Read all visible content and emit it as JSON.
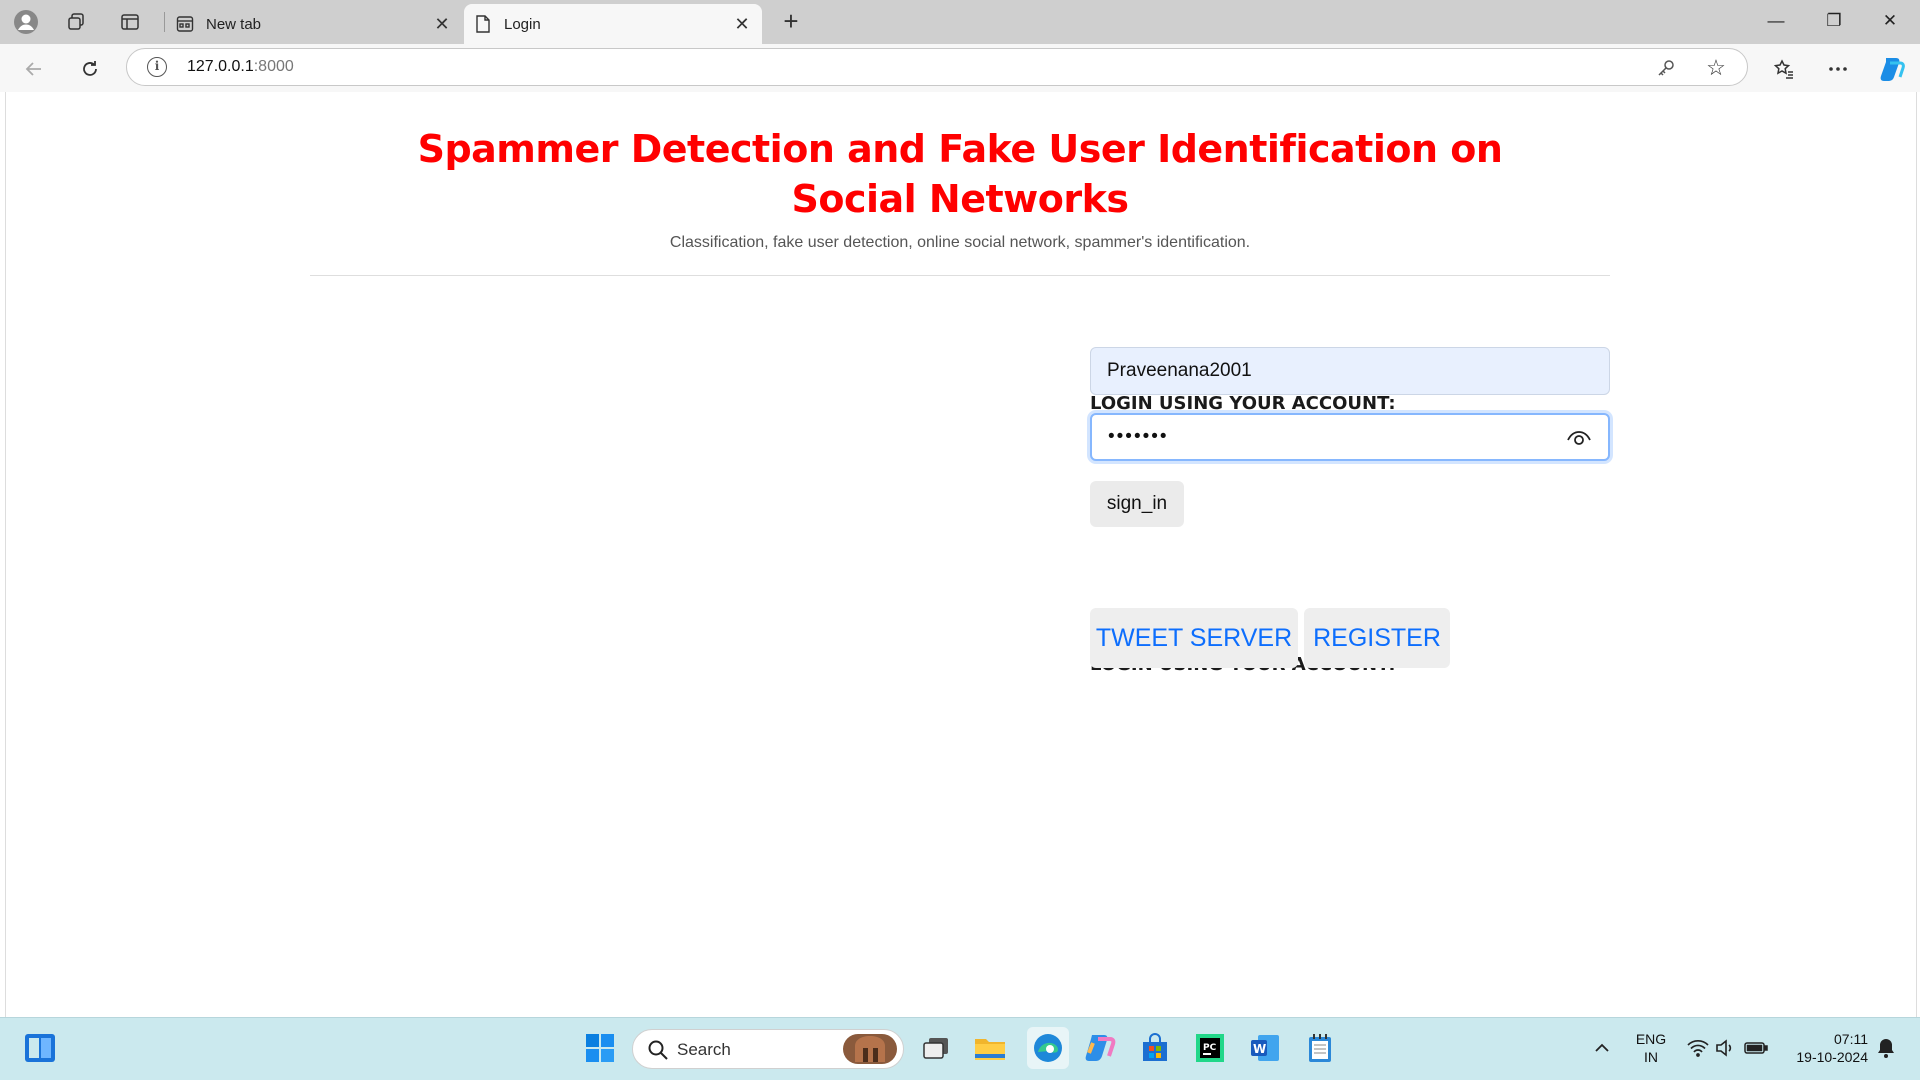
{
  "browser": {
    "tabs": [
      {
        "title": "New tab",
        "active": false
      },
      {
        "title": "Login",
        "active": true
      }
    ],
    "new_tab_symbol": "+",
    "close_symbol": "✕",
    "address": {
      "host": "127.0.0.1",
      "port": ":8000"
    },
    "window_controls": {
      "minimize": "—",
      "restore": "❐",
      "close": "✕"
    }
  },
  "page": {
    "title": "Spammer Detection and Fake User Identification on Social Networks",
    "subtitle": "Classification, fake user detection, online social network, spammer's identification.",
    "login": {
      "heading": "LOGIN USING YOUR ACCOUNT:",
      "username_value": "Praveenana2001",
      "password_mask": "•••••••",
      "signin_label": "sign_in"
    },
    "alt_login": {
      "heading": "LOGIN USING YOUR ACCOUNT:",
      "tweet_server_label": "TWEET SERVER",
      "register_label": "REGISTER"
    }
  },
  "taskbar": {
    "search_label": "Search",
    "language": "ENG",
    "region": "IN",
    "time": "07:11",
    "date": "19-10-2024"
  },
  "colors": {
    "title_red": "#ff0000",
    "link_blue": "#0d6efd",
    "taskbar": "#cbe9ee"
  }
}
